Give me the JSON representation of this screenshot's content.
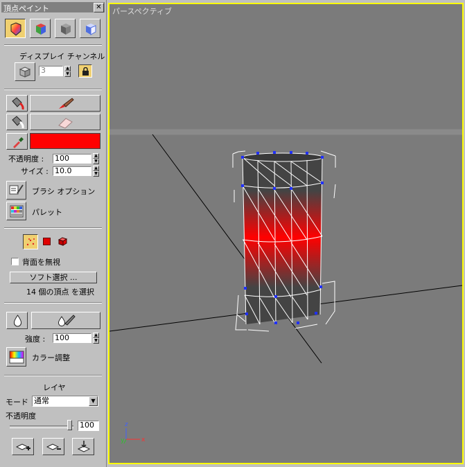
{
  "title": "頂点ペイント",
  "close_label": "✕",
  "display_channel": {
    "label": "ディスプレイ チャンネル",
    "value": "3"
  },
  "opacity": {
    "label": "不透明度 :",
    "value": "100"
  },
  "size": {
    "label": "サイズ :",
    "value": "10.0"
  },
  "brush_options_label": "ブラシ オプション",
  "palette_label": "パレット",
  "ignore_backfacing_label": "背面を無視",
  "soft_selection_label": "ソフト選択 ...",
  "selection_status": "14 個の頂点 を選択",
  "strength": {
    "label": "強度 :",
    "value": "100"
  },
  "color_adjust_label": "カラー調整",
  "layer": {
    "header": "レイヤ",
    "mode_label": "モード",
    "mode_value": "通常",
    "opacity_label": "不透明度",
    "opacity_value": "100"
  },
  "viewport": {
    "title": "パースペクティブ",
    "axis_x": "x",
    "axis_y": "y",
    "axis_z": "z"
  },
  "colors": {
    "paint_color": "#ff0000",
    "viewport_border": "#ffff00",
    "viewport_bg": "#7b7b7b"
  }
}
